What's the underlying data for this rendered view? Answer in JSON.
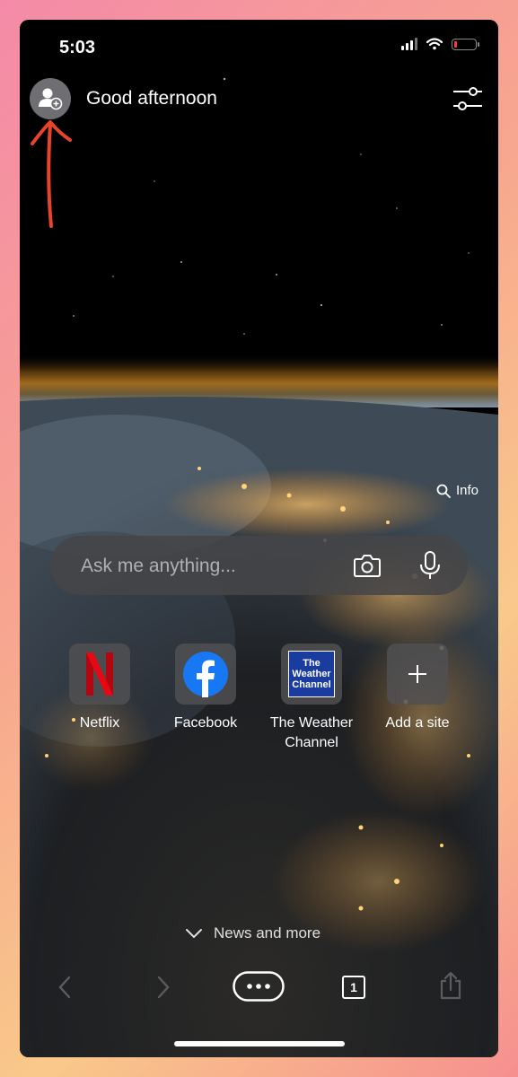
{
  "status_bar": {
    "time": "5:03"
  },
  "header": {
    "greeting": "Good afternoon"
  },
  "wallpaper": {
    "info_label": "Info"
  },
  "search": {
    "placeholder": "Ask me anything..."
  },
  "tiles": [
    {
      "label": "Netflix",
      "icon": "netflix-icon"
    },
    {
      "label": "Facebook",
      "icon": "facebook-icon"
    },
    {
      "label": "The Weather Channel",
      "icon": "weather-channel-icon",
      "logo_text": "The Weather Channel"
    },
    {
      "label": "Add a site",
      "icon": "plus-icon"
    }
  ],
  "news": {
    "label": "News and more"
  },
  "toolbar": {
    "tab_count": "1"
  },
  "colors": {
    "netflix_red": "#e50914",
    "facebook_blue": "#1877f2",
    "weather_blue": "#1a3c9e",
    "annotation_red": "#e8442c"
  }
}
